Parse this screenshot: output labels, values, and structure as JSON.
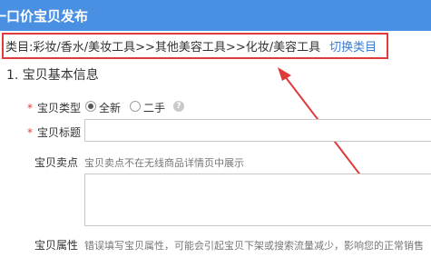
{
  "header": {
    "title": "一口价宝贝发布"
  },
  "category": {
    "prefix": "类目:",
    "path": "彩妆/香水/美妆工具>>其他美容工具>>化妆/美容工具",
    "switch_label": "切换类目"
  },
  "section": {
    "title": "1. 宝贝基本信息"
  },
  "form": {
    "required_mark": "*",
    "type": {
      "label": "宝贝类型",
      "options": [
        {
          "label": "全新",
          "checked": true
        },
        {
          "label": "二手",
          "checked": false
        }
      ],
      "help_icon": "?"
    },
    "title": {
      "label": "宝贝标题",
      "value": ""
    },
    "selling_point": {
      "label": "宝贝卖点",
      "hint": "宝贝卖点不在无线商品详情页中展示",
      "value": ""
    },
    "attributes": {
      "label": "宝贝属性",
      "hint": "错误填写宝贝属性，可能会引起宝贝下架或搜索流量减少，影响您的正常销售"
    }
  },
  "annotation": {
    "arrow_color": "#e03b3b"
  },
  "colors": {
    "header_bg": "#4a90e2",
    "highlight_border": "#e03b3b",
    "link": "#3a7bd5"
  }
}
